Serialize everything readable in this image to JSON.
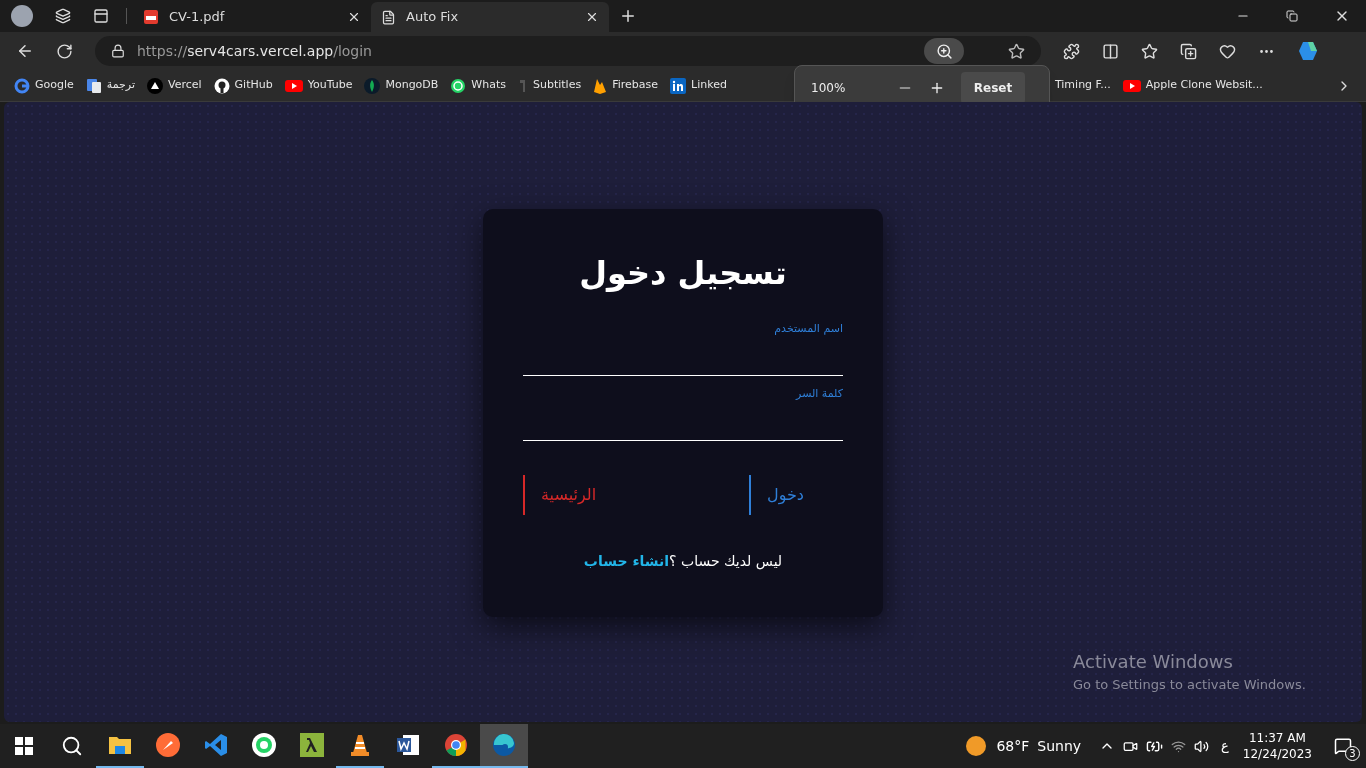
{
  "browser": {
    "tabs": [
      {
        "label": "CV-1.pdf",
        "kind": "pdf",
        "selected": false
      },
      {
        "label": "Auto Fix",
        "kind": "page",
        "selected": true
      }
    ],
    "address": {
      "scheme": "https://",
      "host": "serv4cars.vercel.app",
      "path": "/login"
    },
    "bookmarks": [
      {
        "label": "Google",
        "kind": "google"
      },
      {
        "label": "ترجمة",
        "kind": "translate"
      },
      {
        "label": "Vercel",
        "kind": "vercel"
      },
      {
        "label": "GitHub",
        "kind": "github"
      },
      {
        "label": "YouTube",
        "kind": "youtube"
      },
      {
        "label": "MongoDB",
        "kind": "mongodb"
      },
      {
        "label": "Whats",
        "kind": "whatsapp"
      },
      {
        "label": "Subtitles",
        "kind": "subtitles"
      },
      {
        "label": "Firebase",
        "kind": "firebase"
      },
      {
        "label": "Linked",
        "kind": "linkedin"
      },
      {
        "label": "Timing F...",
        "kind": "none"
      },
      {
        "label": "Apple Clone Websit...",
        "kind": "youtube"
      }
    ],
    "zoom_popup": {
      "value": "100%",
      "reset": "Reset"
    }
  },
  "login": {
    "title": "تسجيل دخول",
    "fields": [
      {
        "label": "اسم المستخدم"
      },
      {
        "label": "كلمة السر"
      }
    ],
    "buttons": [
      {
        "label": "دخول",
        "color": "#2f7fd8"
      },
      {
        "label": "الرئيسية",
        "color": "#d62828"
      }
    ],
    "footer": {
      "text": "ليس لديك حساب ؟",
      "link": "انشاء حساب"
    }
  },
  "activation": {
    "title": "Activate Windows",
    "subtitle": "Go to Settings to activate Windows."
  },
  "taskbar": {
    "apps": [
      {
        "kind": "explorer",
        "running": true,
        "selected": false
      },
      {
        "kind": "postman",
        "running": false,
        "selected": false
      },
      {
        "kind": "vscode",
        "running": false,
        "selected": false
      },
      {
        "kind": "whatsapp",
        "running": false,
        "selected": false
      },
      {
        "kind": "lambda",
        "running": false,
        "selected": false
      },
      {
        "kind": "vlc",
        "running": true,
        "selected": false
      },
      {
        "kind": "word",
        "running": false,
        "selected": false
      },
      {
        "kind": "chrome",
        "running": true,
        "selected": false
      },
      {
        "kind": "edge",
        "running": true,
        "selected": true
      }
    ],
    "weather": {
      "temp": "68°F",
      "condition": "Sunny"
    },
    "language": "ع",
    "time": "11:37 AM",
    "date": "12/24/2023",
    "notifications": "3"
  }
}
